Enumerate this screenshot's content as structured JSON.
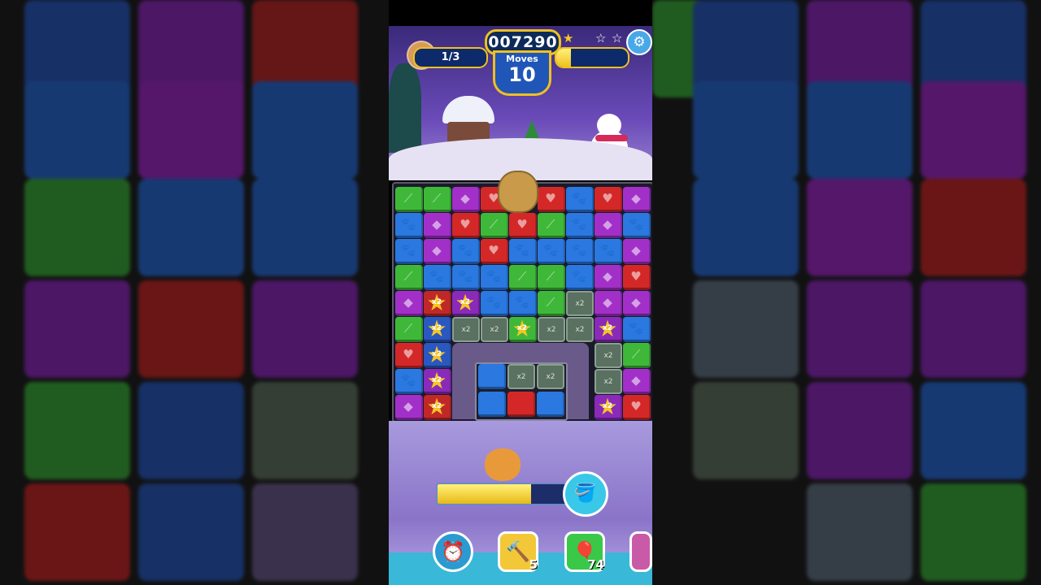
{
  "hud": {
    "score": "007290",
    "moves_label": "Moves",
    "moves_value": "10",
    "goal_progress": "1/3",
    "stars_earned": 1,
    "stars_total": 3,
    "score_progress_fraction": 0.2
  },
  "board": {
    "star_multiplier_label": "x2"
  },
  "lower": {
    "meter_fill_fraction": 0.72
  },
  "boosters": [
    {
      "name": "booster-alarm",
      "count": ""
    },
    {
      "name": "booster-hammer",
      "count": "5"
    },
    {
      "name": "booster-balloons",
      "count": "74"
    }
  ],
  "icons": {
    "settings": "gear-icon",
    "star": "star-icon",
    "paint": "paint-bucket-icon"
  },
  "colors": {
    "green": "#3fb83a",
    "blue": "#2a78e0",
    "red": "#d42828",
    "purple": "#a230c8",
    "gold": "#f0c020"
  }
}
